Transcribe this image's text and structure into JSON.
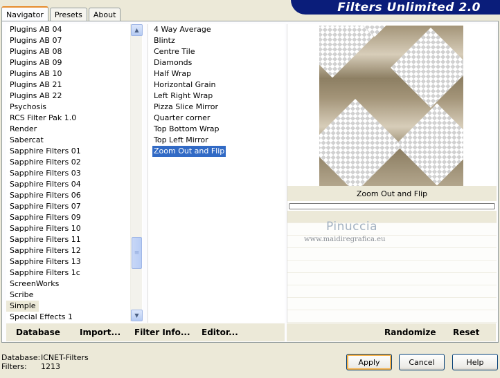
{
  "app": {
    "title": "Filters Unlimited 2.0"
  },
  "tabs": [
    {
      "label": "Navigator",
      "active": true
    },
    {
      "label": "Presets",
      "active": false
    },
    {
      "label": "About",
      "active": false
    }
  ],
  "categories": {
    "items": [
      "Plugins AB 04",
      "Plugins AB 07",
      "Plugins AB 08",
      "Plugins AB 09",
      "Plugins AB 10",
      "Plugins AB 21",
      "Plugins AB 22",
      "Psychosis",
      "RCS Filter Pak 1.0",
      "Render",
      "Sabercat",
      "Sapphire Filters 01",
      "Sapphire Filters 02",
      "Sapphire Filters 03",
      "Sapphire Filters 04",
      "Sapphire Filters 06",
      "Sapphire Filters 07",
      "Sapphire Filters 09",
      "Sapphire Filters 10",
      "Sapphire Filters 11",
      "Sapphire Filters 12",
      "Sapphire Filters 13",
      "Sapphire Filters 1c",
      "ScreenWorks",
      "Scribe",
      "Simple",
      "Special Effects 1"
    ],
    "selected": "Simple"
  },
  "filters": {
    "items": [
      "4 Way Average",
      "Blintz",
      "Centre Tile",
      "Diamonds",
      "Half Wrap",
      "Horizontal Grain",
      "Left Right Wrap",
      "Pizza Slice Mirror",
      "Quarter corner",
      "Top Bottom Wrap",
      "Top Left Mirror",
      "Zoom Out and Flip"
    ],
    "selected": "Zoom Out and Flip"
  },
  "preview": {
    "caption": "Zoom Out and Flip",
    "watermark_name": "Pinuccia",
    "watermark_url": "www.maidiregrafica.eu"
  },
  "left_actions": {
    "database": "Database",
    "import": "Import...",
    "filter_info": "Filter Info...",
    "editor": "Editor..."
  },
  "right_actions": {
    "randomize": "Randomize",
    "reset": "Reset"
  },
  "status": {
    "database_label": "Database:",
    "database_value": "ICNET-Filters",
    "filters_label": "Filters:",
    "filters_value": "1213"
  },
  "dialog_buttons": {
    "apply": "Apply",
    "cancel": "Cancel",
    "help": "Help"
  }
}
